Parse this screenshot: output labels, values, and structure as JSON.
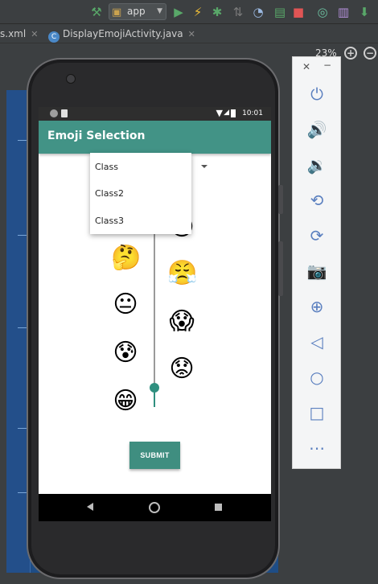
{
  "ide": {
    "run_config": "app",
    "tabs": [
      {
        "label": "s.xml"
      },
      {
        "label": "DisplayEmojiActivity.java",
        "badge": "C"
      }
    ],
    "zoom": "23%"
  },
  "phone": {
    "status_time": "10:01",
    "app_title": "Emoji Selection",
    "dropdown_items": [
      "Class",
      "Class2",
      "Class3"
    ],
    "submit_label": "SUBMIT",
    "emojis_left": [
      "🤔",
      "😐",
      "😰",
      "😁"
    ],
    "emojis_right": [
      "😁",
      "😤",
      "😱",
      "😟"
    ],
    "slider_value": 0.92
  },
  "emulator": {
    "buttons": [
      "power-icon",
      "volume-up-icon",
      "volume-down-icon",
      "rotate-left-icon",
      "rotate-right-icon",
      "camera-icon",
      "zoom-icon",
      "back-icon",
      "home-icon",
      "overview-icon",
      "more-icon"
    ]
  },
  "colors": {
    "app_bar": "#429386",
    "accent": "#3f8e80",
    "ide_bg": "#3c3f41",
    "blueprint": "#1e4d86"
  }
}
